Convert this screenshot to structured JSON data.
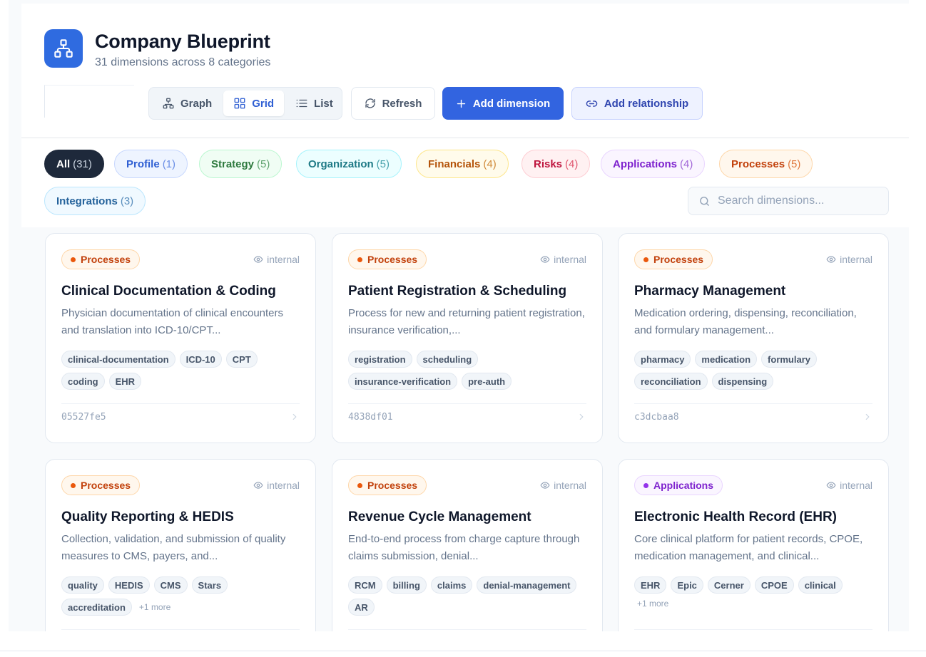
{
  "header": {
    "title": "Company Blueprint",
    "subtitle": "31 dimensions across 8 categories"
  },
  "view_toggle": [
    {
      "label": "Graph",
      "icon": "graph-icon",
      "active": false
    },
    {
      "label": "Grid",
      "icon": "grid-icon",
      "active": true
    },
    {
      "label": "List",
      "icon": "list-icon",
      "active": false
    }
  ],
  "toolbar": {
    "refresh_label": "Refresh",
    "add_dimension_label": "Add dimension",
    "add_relationship_label": "Add relationship"
  },
  "filters": [
    {
      "label": "All",
      "count": "(31)",
      "selected": true
    },
    {
      "label": "Profile",
      "count": "(1)"
    },
    {
      "label": "Strategy",
      "count": "(5)"
    },
    {
      "label": "Organization",
      "count": "(5)"
    },
    {
      "label": "Financials",
      "count": "(4)"
    },
    {
      "label": "Risks",
      "count": "(4)"
    },
    {
      "label": "Applications",
      "count": "(4)"
    },
    {
      "label": "Processes",
      "count": "(5)"
    },
    {
      "label": "Integrations",
      "count": "(3)"
    }
  ],
  "search": {
    "placeholder": "Search dimensions..."
  },
  "colors": {
    "accent": "#3264e0",
    "Processes": "#ea580c",
    "Applications": "#9333ea"
  },
  "cards": [
    {
      "category": "Processes",
      "visibility": "internal",
      "title": "Clinical Documentation & Coding",
      "description": "Physician documentation of clinical encounters and translation into ICD-10/CPT...",
      "tags": [
        "clinical-documentation",
        "ICD-10",
        "CPT",
        "coding",
        "EHR"
      ],
      "more": "",
      "id": "05527fe5"
    },
    {
      "category": "Processes",
      "visibility": "internal",
      "title": "Patient Registration & Scheduling",
      "description": "Process for new and returning patient registration, insurance verification,...",
      "tags": [
        "registration",
        "scheduling",
        "insurance-verification",
        "pre-auth"
      ],
      "more": "",
      "id": "4838df01"
    },
    {
      "category": "Processes",
      "visibility": "internal",
      "title": "Pharmacy Management",
      "description": "Medication ordering, dispensing, reconciliation, and formulary management...",
      "tags": [
        "pharmacy",
        "medication",
        "formulary",
        "reconciliation",
        "dispensing"
      ],
      "more": "",
      "id": "c3dcbaa8"
    },
    {
      "category": "Processes",
      "visibility": "internal",
      "title": "Quality Reporting & HEDIS",
      "description": "Collection, validation, and submission of quality measures to CMS, payers, and...",
      "tags": [
        "quality",
        "HEDIS",
        "CMS",
        "Stars",
        "accreditation"
      ],
      "more": "+1 more",
      "id": ""
    },
    {
      "category": "Processes",
      "visibility": "internal",
      "title": "Revenue Cycle Management",
      "description": "End-to-end process from charge capture through claims submission, denial...",
      "tags": [
        "RCM",
        "billing",
        "claims",
        "denial-management",
        "AR"
      ],
      "more": "",
      "id": ""
    },
    {
      "category": "Applications",
      "visibility": "internal",
      "title": "Electronic Health Record (EHR)",
      "description": "Core clinical platform for patient records, CPOE, medication management, and clinical...",
      "tags": [
        "EHR",
        "Epic",
        "Cerner",
        "CPOE",
        "clinical"
      ],
      "more": "+1 more",
      "id": ""
    }
  ]
}
